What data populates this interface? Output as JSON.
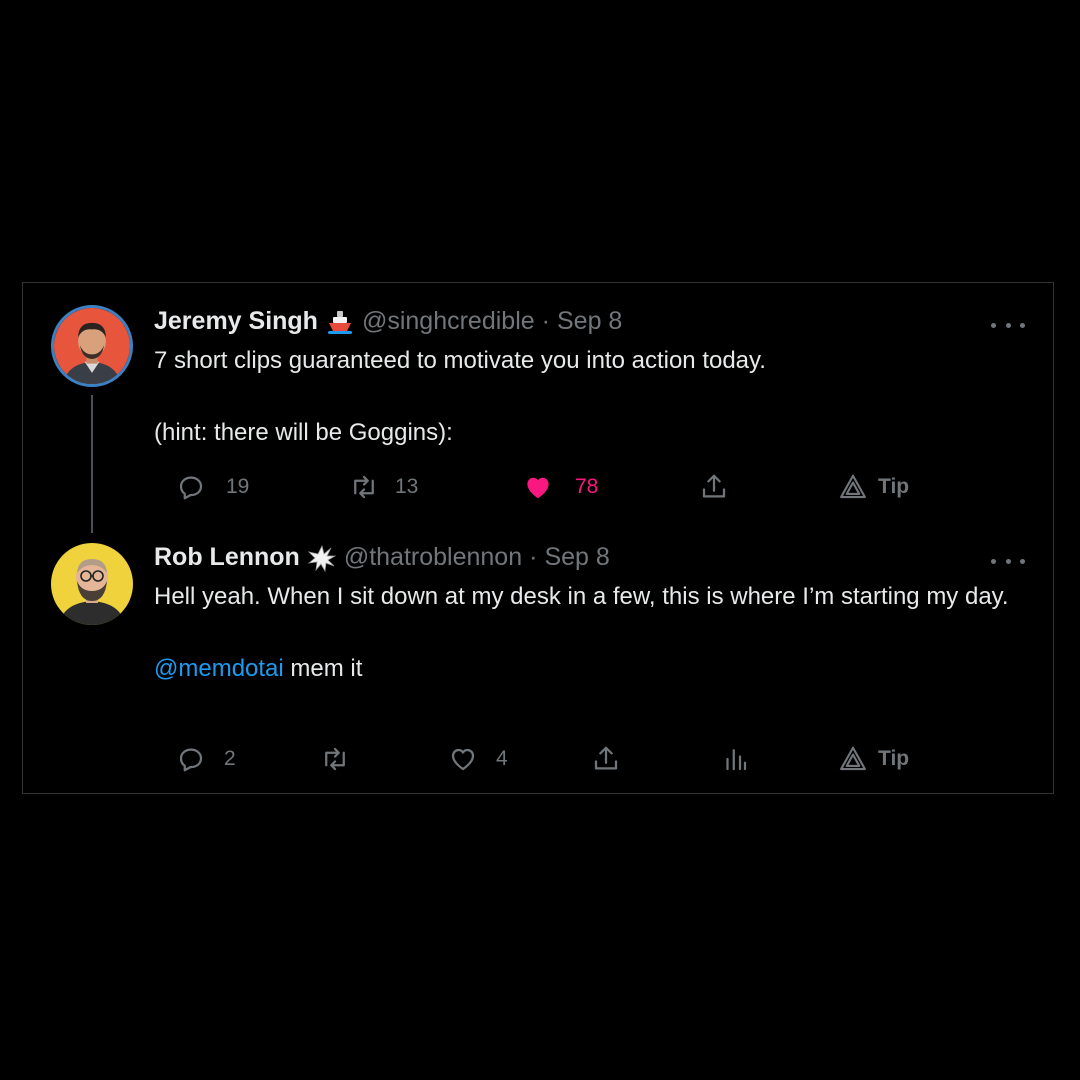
{
  "tweets": [
    {
      "name": "Jeremy Singh",
      "badge_icon": "ship-emoji",
      "handle": "@singhcredible",
      "separator": "·",
      "date": "Sep 8",
      "lines": [
        "7 short clips guaranteed to motivate you into action today.",
        "(hint: there will be Goggins):"
      ],
      "actions": {
        "reply_count": "19",
        "retweet_count": "13",
        "like_count": "78",
        "liked": true,
        "tip_label": "Tip"
      }
    },
    {
      "name": "Rob Lennon",
      "badge_icon": "explosion-emoji",
      "handle": "@thatroblennon",
      "separator": "·",
      "date": "Sep 8",
      "lines": [
        "Hell yeah. When I sit down at my desk in a few, this is where I’m starting my day."
      ],
      "mention": "@memdotai",
      "mention_suffix": " mem it",
      "actions": {
        "reply_count": "2",
        "retweet_count": "",
        "like_count": "4",
        "liked": false,
        "tip_label": "Tip"
      }
    }
  ],
  "colors": {
    "background": "#000000",
    "text": "#e7e9ea",
    "muted": "#71767b",
    "like": "#f91880",
    "link": "#1d9bf0",
    "border": "#2f3336"
  }
}
